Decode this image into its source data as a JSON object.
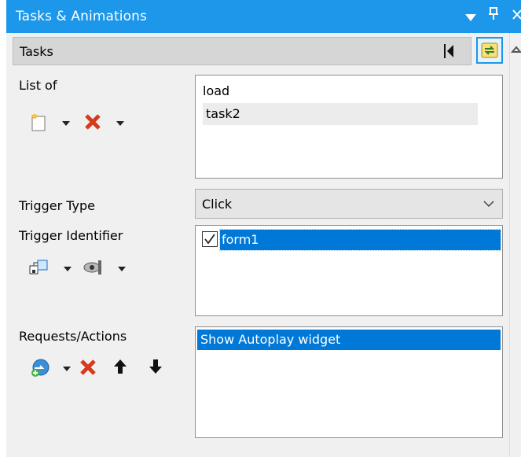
{
  "window": {
    "title": "Tasks & Animations",
    "menu_icon": "dropdown-arrow-icon",
    "pin_icon": "pin-icon",
    "close_icon": "close-icon"
  },
  "tab": {
    "label": "Tasks"
  },
  "list_of": {
    "label": "List of",
    "items": [
      "load",
      "task2"
    ]
  },
  "trigger_type": {
    "label": "Trigger Type",
    "value": "Click"
  },
  "trigger_identifier": {
    "label": "Trigger Identifier",
    "items": [
      {
        "label": "form1",
        "checked": true
      }
    ]
  },
  "requests_actions": {
    "label": "Requests/Actions",
    "items": [
      "Show Autoplay widget"
    ]
  },
  "colors": {
    "titlebar": "#1c97ea",
    "selection": "#0078d7",
    "panel": "#f0f0f0"
  }
}
